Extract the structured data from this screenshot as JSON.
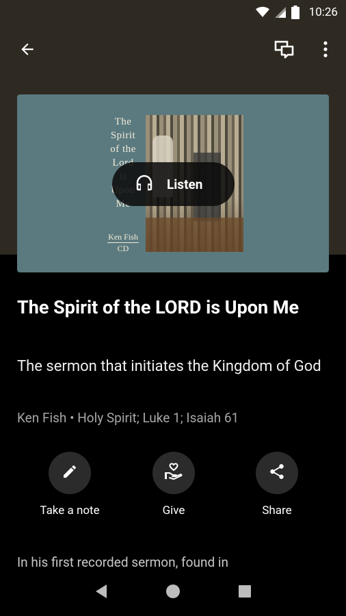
{
  "status_bar": {
    "time": "10:26",
    "icons": [
      "wifi-icon",
      "cell-signal-icon",
      "battery-icon"
    ]
  },
  "toolbar": {
    "back_icon": "arrow-left-icon",
    "chat_icon": "chat-bubbles-icon",
    "more_icon": "more-vert-icon"
  },
  "artwork": {
    "title_lines": [
      "The",
      "Spirit",
      "of the",
      "Lord",
      "is",
      "Upon",
      "Me"
    ],
    "author": "Ken Fish",
    "format": "CD",
    "background_color": "#5b7a7f"
  },
  "listen_button": {
    "label": "Listen",
    "icon": "headphones-icon"
  },
  "sermon": {
    "title": "The Spirit of the LORD is Upon Me",
    "subtitle": "The sermon that initiates the Kingdom of God",
    "meta": "Ken Fish • Holy Spirit; Luke 1; Isaiah 61",
    "description": "In his first recorded sermon, found in"
  },
  "actions": [
    {
      "label": "Take a note",
      "icon": "pencil-icon"
    },
    {
      "label": "Give",
      "icon": "heart-hand-icon"
    },
    {
      "label": "Share",
      "icon": "share-icon"
    }
  ],
  "nav_bar": {
    "back_icon": "nav-back-icon",
    "home_icon": "nav-home-icon",
    "recents_icon": "nav-recents-icon"
  },
  "colors": {
    "header_background": "#2e2a22",
    "page_background": "#000000",
    "action_circle": "#2b2b2b",
    "meta_text": "#a7a7a7"
  }
}
